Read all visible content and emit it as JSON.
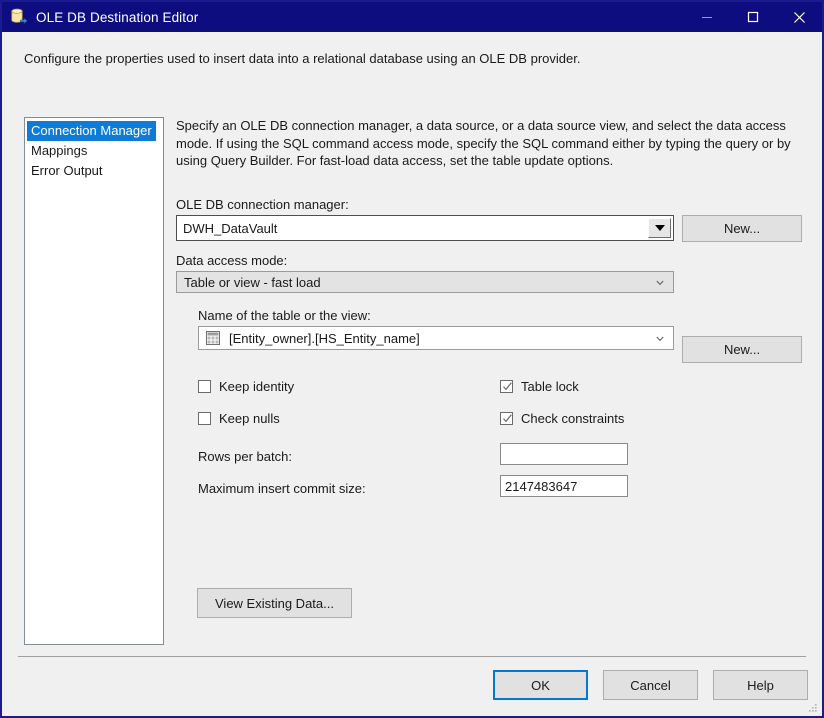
{
  "window": {
    "title": "OLE DB Destination Editor",
    "icon": "database-destination-icon",
    "minimize_label": "—",
    "maximize_label": "□",
    "close_label": "✕"
  },
  "header": {
    "description": "Configure the properties used to insert data into a relational database using an OLE DB provider."
  },
  "nav": {
    "items": [
      {
        "label": "Connection Manager",
        "selected": true
      },
      {
        "label": "Mappings",
        "selected": false
      },
      {
        "label": "Error Output",
        "selected": false
      }
    ]
  },
  "main": {
    "instructions": "Specify an OLE DB connection manager, a data source, or a data source view, and select the data access mode. If using the SQL command access mode, specify the SQL command either by typing the query or by using Query Builder. For fast-load data access, set the table update options.",
    "connection_manager": {
      "label": "OLE DB connection manager:",
      "value": "DWH_DataVault",
      "new_button": "New..."
    },
    "data_access_mode": {
      "label": "Data access mode:",
      "value": "Table or view - fast load"
    },
    "table_or_view": {
      "label": "Name of the table or the view:",
      "value": "[Entity_owner].[HS_Entity_name]",
      "icon": "table-grid-icon",
      "new_button": "New..."
    },
    "options": [
      {
        "label": "Keep identity",
        "checked": false
      },
      {
        "label": "Keep nulls",
        "checked": false
      },
      {
        "label": "Table lock",
        "checked": true
      },
      {
        "label": "Check constraints",
        "checked": true
      }
    ],
    "rows_per_batch": {
      "label": "Rows per batch:",
      "value": ""
    },
    "max_insert_commit_size": {
      "label": "Maximum insert commit size:",
      "value": "2147483647"
    },
    "view_existing_data_button": "View Existing Data..."
  },
  "footer": {
    "ok": "OK",
    "cancel": "Cancel",
    "help": "Help"
  },
  "colors": {
    "titlebar": "#0d0d80",
    "window_border": "#1b1b8f",
    "dialog_bg": "#f0f0f0",
    "selection": "#0e7bd6",
    "focus_accent": "#0078d7"
  }
}
